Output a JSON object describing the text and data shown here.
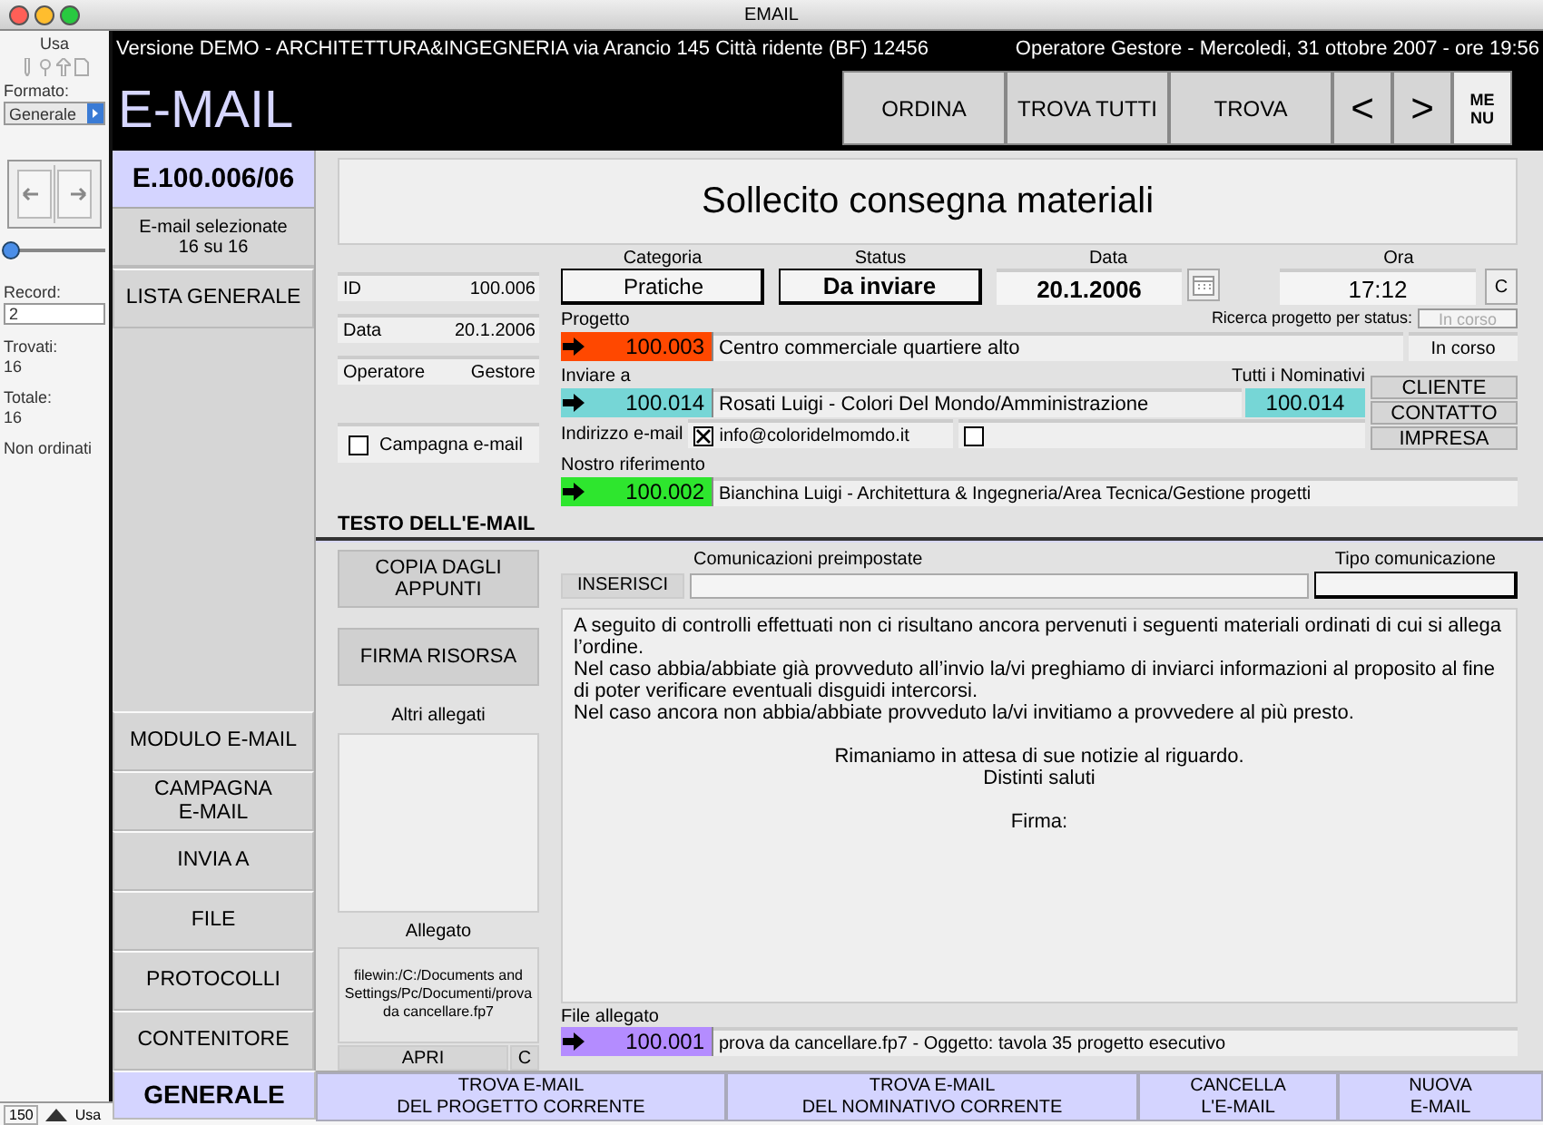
{
  "window": {
    "title": "EMAIL"
  },
  "status_pane": {
    "mode": "Usa",
    "format_label": "Formato:",
    "format": "Generale",
    "slider": {
      "level": 0.07
    },
    "record_label": "Record:",
    "record": "2",
    "found_label": "Trovati:",
    "found": "16",
    "total_label": "Totale:",
    "total": "16",
    "sort_state": "Non ordinati",
    "zoom": "150",
    "status_mode": "Usa"
  },
  "header": {
    "version": "Versione DEMO - ARCHITETTURA&INGEGNERIA via Arancio 145 Città ridente (BF) 12456",
    "operator": "Operatore Gestore - Mercoledi, 31 ottobre 2007 - ore 19:56",
    "title": "E-MAIL",
    "buttons": [
      {
        "label": "ORDINA",
        "kind": "wide"
      },
      {
        "label": "TROVA TUTTI",
        "kind": "wide"
      },
      {
        "label": "TROVA",
        "kind": "wide"
      },
      {
        "label": "<",
        "kind": "arrow"
      },
      {
        "label": ">",
        "kind": "arrow"
      },
      {
        "label": "ME\nNU",
        "kind": "menu"
      }
    ]
  },
  "sidebar": {
    "record_id": "E.100.006/06",
    "selection": "E-mail selezionate\n16 su 16",
    "list_button": "LISTA GENERALE",
    "items": [
      {
        "label": "MODULO E-MAIL",
        "selected": false
      },
      {
        "label": "CAMPAGNA\nE-MAIL",
        "selected": false
      },
      {
        "label": "INVIA A",
        "selected": false
      },
      {
        "label": "FILE",
        "selected": false
      },
      {
        "label": "PROTOCOLLI",
        "selected": false
      },
      {
        "label": "CONTENITORE",
        "selected": false
      },
      {
        "label": "GENERALE",
        "selected": true
      }
    ]
  },
  "record": {
    "title": "Sollecito consegna materiali",
    "info": [
      {
        "label": "ID",
        "value": "100.006"
      },
      {
        "label": "Data",
        "value": "20.1.2006"
      },
      {
        "label": "Operatore",
        "value": "Gestore"
      }
    ],
    "campaign": {
      "label": "Campagna e-mail",
      "checked": false
    },
    "section_title": "TESTO DELL'E-MAIL",
    "fields": [
      {
        "label": "Categoria",
        "value": "Pratiche",
        "kind": "popup"
      },
      {
        "label": "Status",
        "value": "Da inviare",
        "kind": "strong"
      },
      {
        "label": "Data",
        "value": "20.1.2006",
        "kind": "date"
      },
      {
        "label": "Ora",
        "value": "17:12",
        "kind": "time",
        "button": "C"
      }
    ],
    "project": {
      "label": "Progetto",
      "id": "100.003",
      "name": "Centro commerciale quartiere alto",
      "status": "In corso",
      "search_label": "Ricerca progetto per status:",
      "search_value": "In corso",
      "search_disabled": true
    },
    "recipient": {
      "label": "Inviare a",
      "all_label": "Tutti i Nominativi",
      "id": "100.014",
      "name": "Rosati Luigi - Colori Del Mondo/Amministrazione",
      "contact_id": "100.014",
      "email_label": "Indirizzo e-mail",
      "email_checked": true,
      "email": "info@coloridelmomdo.it",
      "extra_checked": false,
      "buttons": [
        "CLIENTE",
        "CONTATTO",
        "IMPRESA"
      ]
    },
    "reference": {
      "label": "Nostro riferimento",
      "id": "100.002",
      "name": "Bianchina Luigi - Architettura & Ingegneria/Area Tecnica/Gestione progetti"
    }
  },
  "text_section": {
    "buttons": [
      "COPIA DAGLI\nAPPUNTI",
      "FIRMA RISORSA"
    ],
    "other_attachments_label": "Altri allegati",
    "attachment_label": "Allegato",
    "attachment_path": "filewin:/C:/Documents and Settings/Pc/Documenti/prova da cancellare.fp7",
    "open_button": "APRI",
    "clear_button": "C",
    "presets_label": "Comunicazioni preimpostate",
    "insert_button": "INSERISCI",
    "type_label": "Tipo comunicazione",
    "body": [
      {
        "text": "A seguito di controlli effettuati non ci risultano ancora pervenuti i seguenti materiali ordinati di cui si allega l’ordine.",
        "kind": "body"
      },
      {
        "text": "Nel caso abbia/abbiate già provveduto all’invio la/vi preghiamo di inviarci informazioni al proposito al fine di poter verificare eventuali disguidi intercorsi.",
        "kind": "body"
      },
      {
        "text": "Nel caso ancora non abbia/abbiate provveduto la/vi invitiamo a provvedere al più presto.",
        "kind": "body"
      },
      {
        "text": "Rimaniamo in attesa di sue notizie al riguardo.",
        "kind": "closing"
      },
      {
        "text": "Distinti saluti",
        "kind": "closing"
      },
      {
        "text": "Firma:",
        "kind": "closing"
      }
    ],
    "file": {
      "label": "File allegato",
      "id": "100.001",
      "name": "prova da cancellare.fp7 - Oggetto: tavola 35 progetto esecutivo"
    }
  },
  "bottom_buttons": [
    "TROVA E-MAIL\nDEL PROGETTO CORRENTE",
    "TROVA E-MAIL\nDEL NOMINATIVO CORRENTE",
    "CANCELLA\nL'E-MAIL",
    "NUOVA\nE-MAIL"
  ]
}
